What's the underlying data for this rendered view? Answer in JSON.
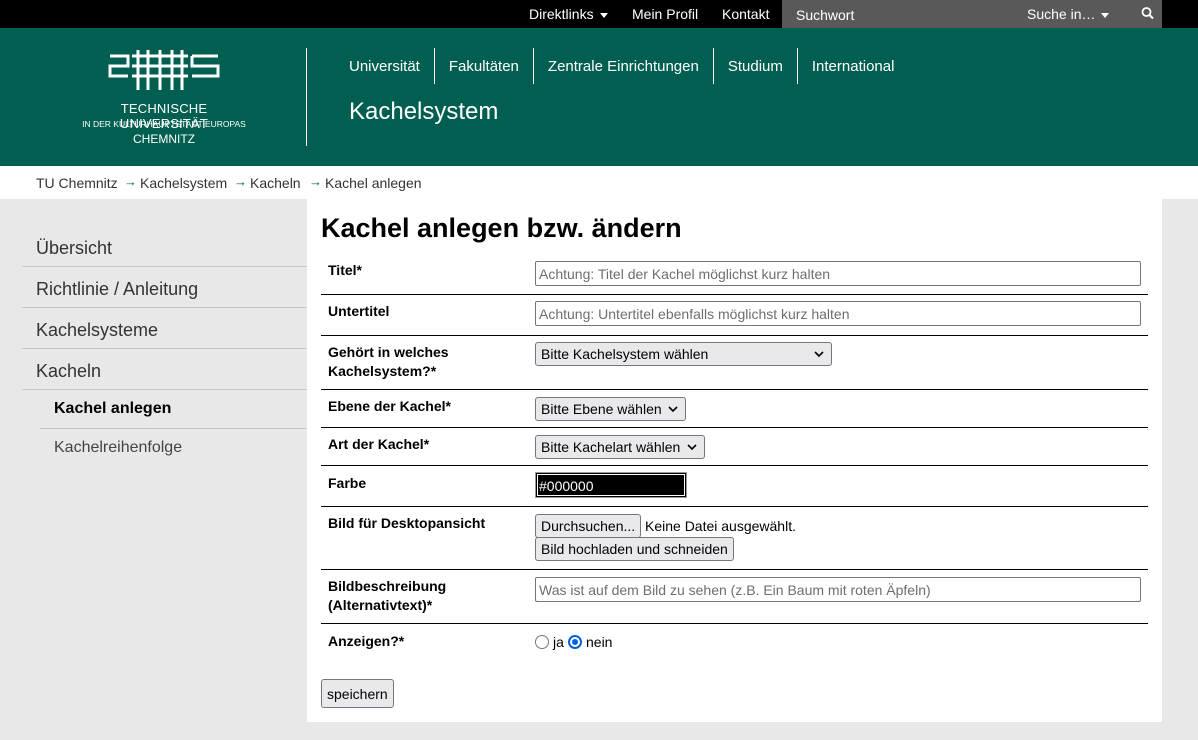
{
  "topbar": {
    "direktlinks": "Direktlinks",
    "profil": "Mein Profil",
    "kontakt": "Kontakt",
    "search_placeholder": "Suchwort",
    "search_in": "Suche in…"
  },
  "header": {
    "logo_line1": "TECHNISCHE UNIVERSITÄT",
    "logo_line2": "IN DER KULTURHAUPTSTADT EUROPAS",
    "logo_line3": "CHEMNITZ",
    "nav": [
      "Universität",
      "Fakultäten",
      "Zentrale Einrichtungen",
      "Studium",
      "International"
    ],
    "site_title": "Kachelsystem"
  },
  "breadcrumb": [
    "TU Chemnitz",
    "Kachelsystem",
    "Kacheln",
    "Kachel anlegen"
  ],
  "sidebar": {
    "items": [
      "Übersicht",
      "Richtlinie / Anleitung",
      "Kachelsysteme",
      "Kacheln"
    ],
    "subitems": [
      "Kachel anlegen",
      "Kachelreihenfolge"
    ]
  },
  "form": {
    "heading": "Kachel anlegen bzw. ändern",
    "titel_label": "Titel*",
    "titel_placeholder": "Achtung: Titel der Kachel möglichst kurz halten",
    "untertitel_label": "Untertitel",
    "untertitel_placeholder": "Achtung: Untertitel ebenfalls möglichst kurz halten",
    "system_label_1": "Gehört in welches",
    "system_label_2": "Kachelsystem?*",
    "system_value": "Bitte Kachelsystem wählen",
    "ebene_label": "Ebene der Kachel*",
    "ebene_value": "Bitte Ebene wählen",
    "art_label": "Art der Kachel*",
    "art_value": "Bitte Kachelart wählen",
    "farbe_label": "Farbe",
    "farbe_value": "#000000",
    "bild_label": "Bild für Desktopansicht",
    "browse_label": "Durchsuchen...",
    "no_file": "Keine Datei ausgewählt.",
    "upload_label": "Bild hochladen und schneiden",
    "alt_label_1": "Bildbeschreibung",
    "alt_label_2": "(Alternativtext)*",
    "alt_placeholder": "Was ist auf dem Bild zu sehen (z.B. Ein Baum mit roten Äpfeln)",
    "anzeigen_label": "Anzeigen?*",
    "ja": "ja",
    "nein": "nein",
    "save_label": "speichern"
  },
  "colors": {
    "brand": "#005f50",
    "radio_selected": "#0060df"
  }
}
